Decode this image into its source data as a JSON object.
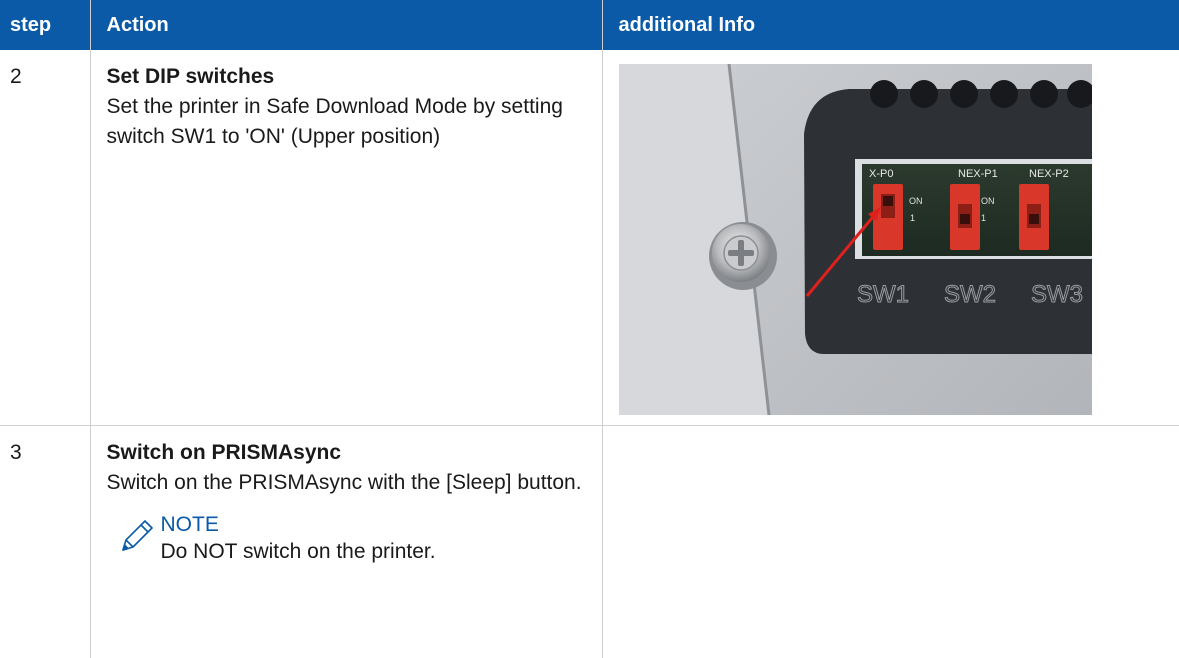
{
  "table": {
    "headers": [
      "step",
      "Action",
      "additional Info"
    ],
    "rows": [
      {
        "step": "2",
        "title": "Set DIP switches",
        "text": "Set the printer in Safe Download Mode by setting switch SW1 to 'ON' (Upper position)"
      },
      {
        "step": "3",
        "title": "Switch on PRISMAsync",
        "text": "Switch on the PRISMAsync with the [Sleep] button.",
        "note_title": "NOTE",
        "note_text": "Do NOT switch on the printer."
      }
    ]
  },
  "photo": {
    "labels": [
      "X-P0",
      "NEX-P1",
      "NEX-P2",
      "ON",
      "ON",
      "1",
      "1",
      "SW1",
      "SW2",
      "SW3"
    ]
  },
  "colors": {
    "header_bg": "#0a5aa8",
    "note_accent": "#0a5aa8",
    "switch_red": "#d8372a",
    "arrow": "#e0201c"
  },
  "icons": {
    "note": "pencil-icon"
  }
}
